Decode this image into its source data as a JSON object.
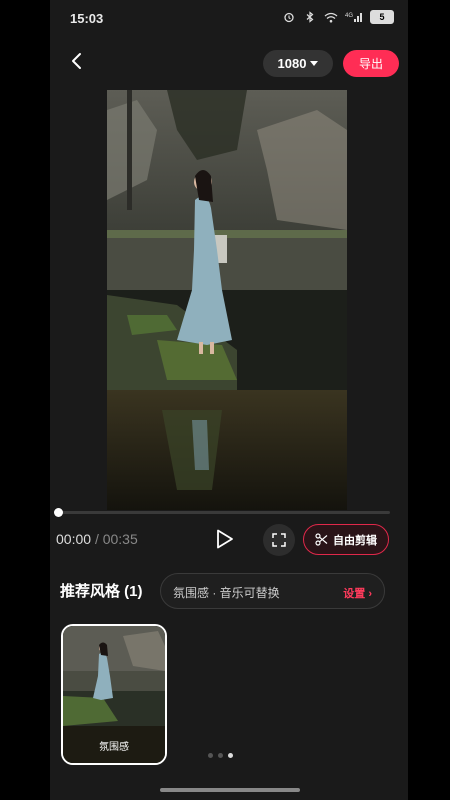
{
  "status": {
    "time": "15:03",
    "battery": "5",
    "network": "4G"
  },
  "toolbar": {
    "resolution": "1080",
    "export_label": "导出"
  },
  "player": {
    "current_time": "00:00",
    "separator": "/",
    "total_time": "00:35",
    "progress": 0,
    "edit_label": "自由剪辑"
  },
  "styles": {
    "section_title": "推荐风格 (1)",
    "pill_desc": "氛围感 · 音乐可替换",
    "settings_label": "设置",
    "items": [
      {
        "label": "氛围感"
      }
    ]
  },
  "pager": {
    "count": 3,
    "active": 2
  },
  "colors": {
    "accent": "#ff2d55",
    "background": "#1a1a1a"
  }
}
